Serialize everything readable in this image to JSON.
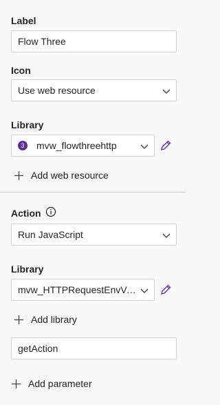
{
  "label_section": {
    "title": "Label",
    "value": "Flow Three"
  },
  "icon_section": {
    "title": "Icon",
    "value": "Use web resource"
  },
  "library_section_1": {
    "title": "Library",
    "badge": "3",
    "value": "mvw_flowthreehttp",
    "add_label": "Add web resource"
  },
  "action_section": {
    "title": "Action",
    "value": "Run JavaScript"
  },
  "library_section_2": {
    "title": "Library",
    "value": "mvw_HTTPRequestEnvVari...",
    "add_label": "Add library"
  },
  "function_field": {
    "value": "getAction"
  },
  "parameter": {
    "add_label": "Add parameter"
  },
  "colors": {
    "accent": "#5c2e91",
    "field_border": "#d1d1d1",
    "background": "#f8f8f8"
  }
}
